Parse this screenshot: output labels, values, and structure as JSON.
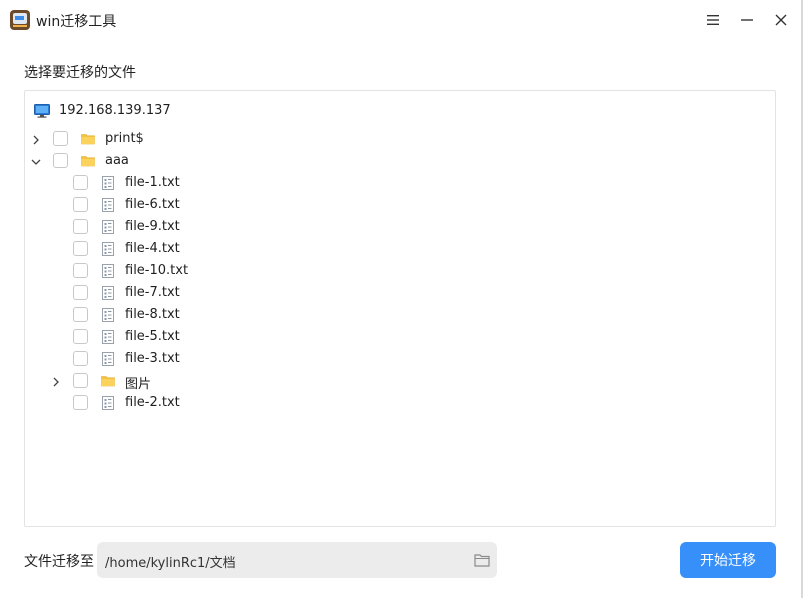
{
  "window": {
    "title": "win迁移工具"
  },
  "section_label": "选择要迁移的文件",
  "tree": {
    "host": "192.168.139.137",
    "items": [
      {
        "label": "print$",
        "type": "folder",
        "expander": "collapsed",
        "depth": 0
      },
      {
        "label": "aaa",
        "type": "folder",
        "expander": "expanded",
        "depth": 0
      },
      {
        "label": "file-1.txt",
        "type": "file",
        "expander": "none",
        "depth": 1
      },
      {
        "label": "file-6.txt",
        "type": "file",
        "expander": "none",
        "depth": 1
      },
      {
        "label": "file-9.txt",
        "type": "file",
        "expander": "none",
        "depth": 1
      },
      {
        "label": "file-4.txt",
        "type": "file",
        "expander": "none",
        "depth": 1
      },
      {
        "label": "file-10.txt",
        "type": "file",
        "expander": "none",
        "depth": 1
      },
      {
        "label": "file-7.txt",
        "type": "file",
        "expander": "none",
        "depth": 1
      },
      {
        "label": "file-8.txt",
        "type": "file",
        "expander": "none",
        "depth": 1
      },
      {
        "label": "file-5.txt",
        "type": "file",
        "expander": "none",
        "depth": 1
      },
      {
        "label": "file-3.txt",
        "type": "file",
        "expander": "none",
        "depth": 1
      },
      {
        "label": "图片",
        "type": "folder",
        "expander": "collapsed",
        "depth": 1
      },
      {
        "label": "file-2.txt",
        "type": "file",
        "expander": "none",
        "depth": 1
      }
    ]
  },
  "destination": {
    "label": "文件迁移至",
    "path": "/home/kylinRc1/文档"
  },
  "start_button": "开始迁移",
  "colors": {
    "accent": "#3790fa",
    "folder": "#f5c342"
  }
}
